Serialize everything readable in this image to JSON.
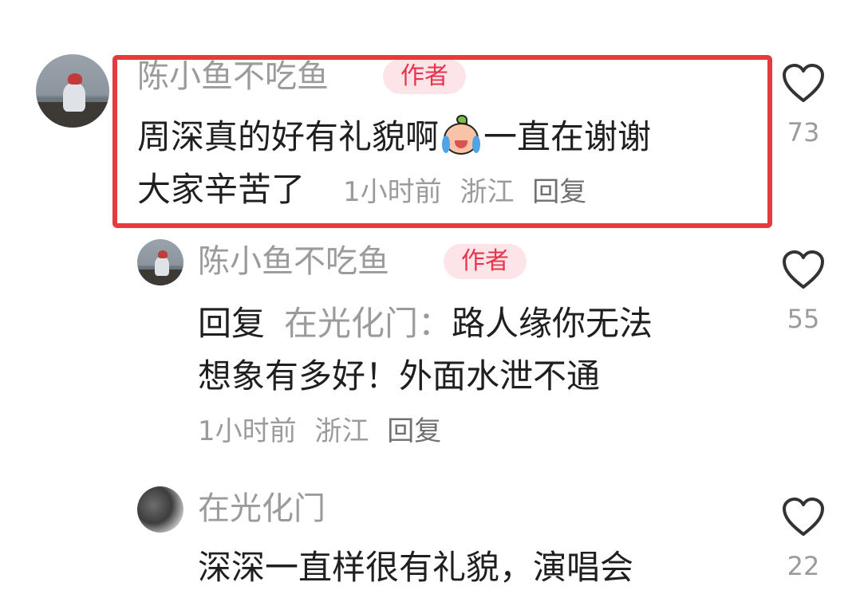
{
  "comments": [
    {
      "author": "陈小鱼不吃鱼",
      "badge": "作者",
      "text_line1_a": "周深真的好有礼貌啊",
      "text_line1_b": "一直在谢谢",
      "text_line2": "大家辛苦了",
      "time": "1小时前",
      "location": "浙江",
      "reply_label": "回复",
      "likes": "73",
      "emoji": "crying-sprout-emoji"
    },
    {
      "author": "陈小鱼不吃鱼",
      "badge": "作者",
      "reply_prefix": "回复",
      "reply_to": "在光化门：",
      "text_line1": "路人缘你无法",
      "text_line2": "想象有多好！外面水泄不通",
      "time": "1小时前",
      "location": "浙江",
      "reply_label": "回复",
      "likes": "55"
    },
    {
      "author": "在光化门",
      "text_line1": "深深一直样很有礼貌，演唱会",
      "likes": "22"
    }
  ],
  "icons": {
    "like": "heart-outline-icon"
  },
  "colors": {
    "highlight": "#e53a3e",
    "badge_text": "#e7334b",
    "badge_bg": "#fde4e8",
    "muted": "#9b9b9b"
  }
}
